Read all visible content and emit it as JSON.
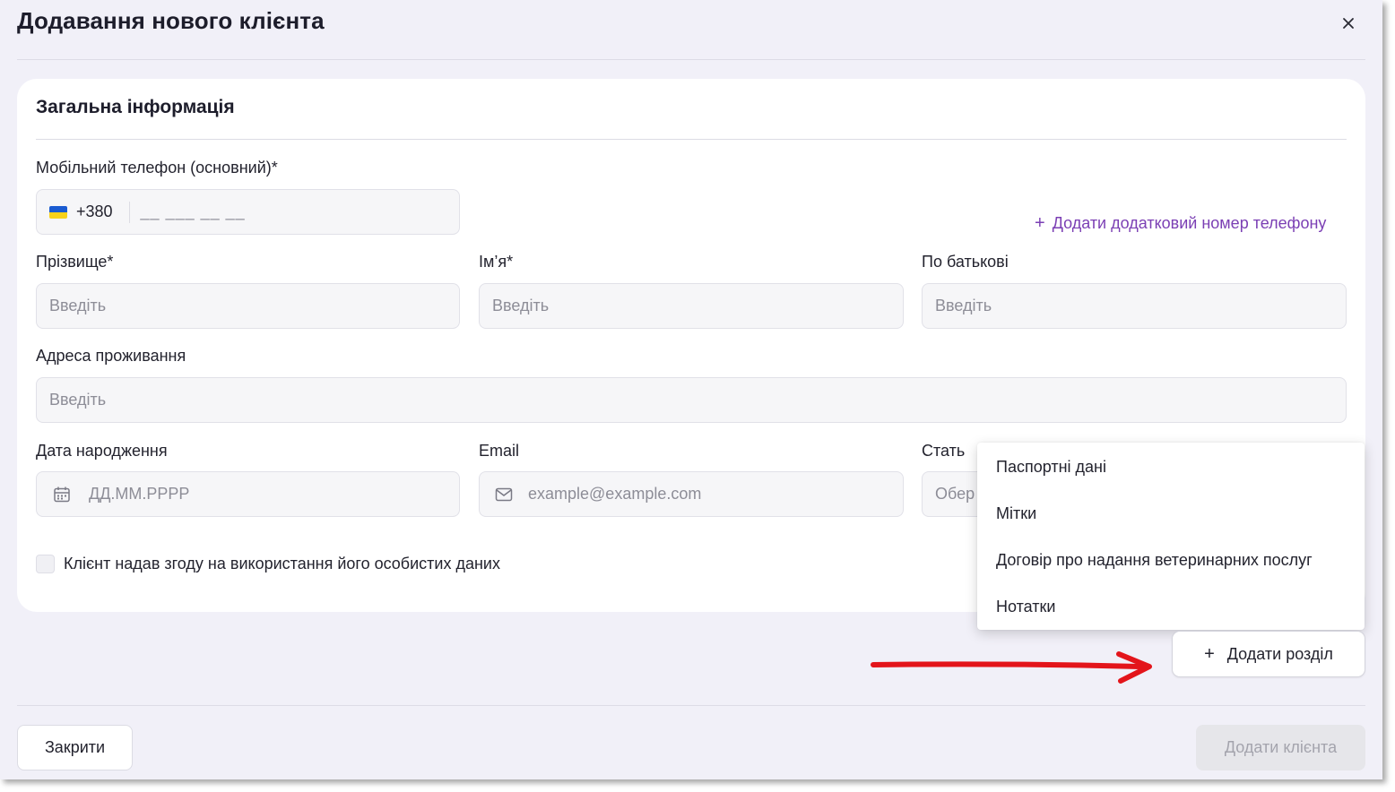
{
  "dialog": {
    "title": "Додавання нового клієнта"
  },
  "general": {
    "title": "Загальна інформація",
    "phone_label": "Мобільний телефон (основний)*",
    "phone_code": "+380",
    "phone_mask": "__ ___ __ __",
    "add_phone_label": "Додати додатковий номер телефону",
    "surname_label": "Прізвище*",
    "surname_placeholder": "Введіть",
    "name_label": "Ім’я*",
    "name_placeholder": "Введіть",
    "patronymic_label": "По батькові",
    "patronymic_placeholder": "Введіть",
    "address_label": "Адреса проживання",
    "address_placeholder": "Введіть",
    "birthdate_label": "Дата народження",
    "birthdate_placeholder": "ДД.ММ.РРРР",
    "email_label": "Email",
    "email_placeholder": "example@example.com",
    "gender_label": "Стать",
    "gender_placeholder": "Обер",
    "consent_label": "Клієнт надав згоду на використання його особистих даних"
  },
  "menu": {
    "items": [
      "Паспортні дані",
      "Мітки",
      "Договір про надання ветеринарних послуг",
      "Нотатки"
    ]
  },
  "actions": {
    "add_section": "Додати розділ",
    "close": "Закрити",
    "add_client": "Додати клієнта"
  },
  "colors": {
    "accent": "#7b3fb4",
    "annotation_arrow": "#e3151b"
  }
}
